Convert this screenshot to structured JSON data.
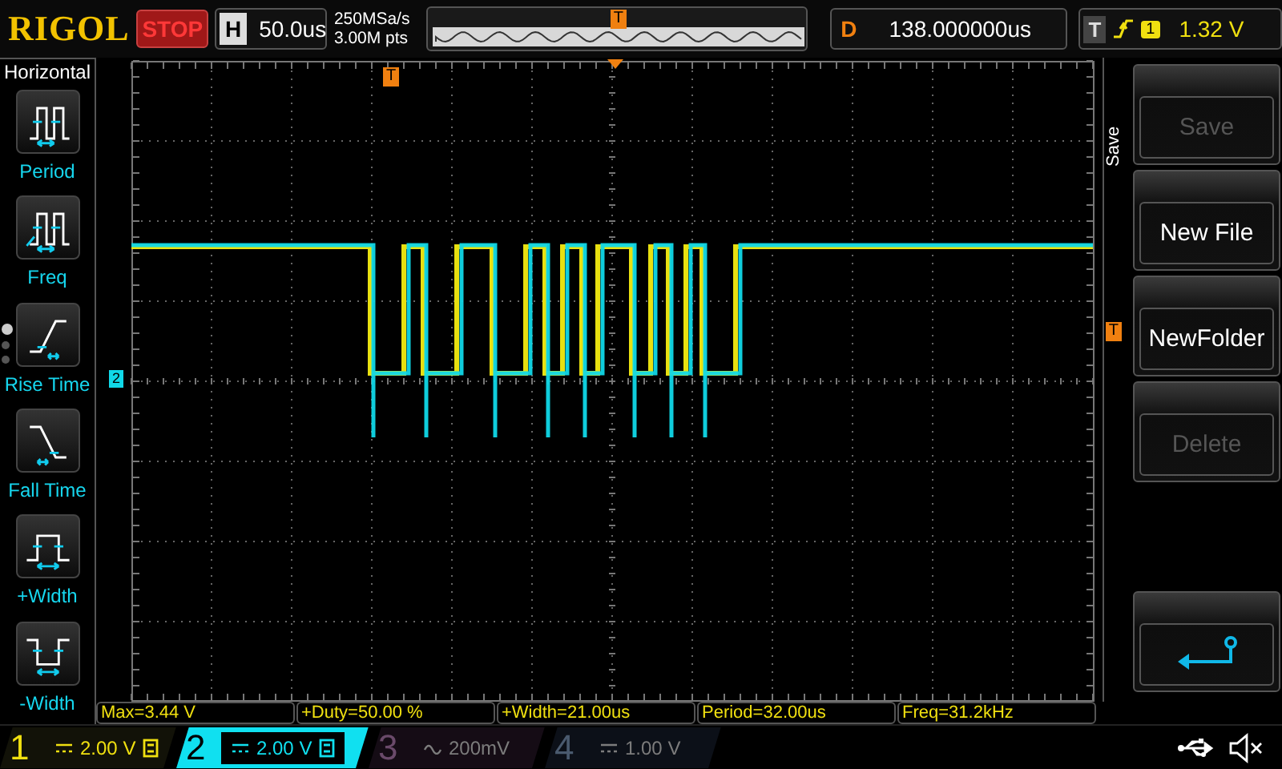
{
  "logo": "RIGOL",
  "run_state": "STOP",
  "timebase": {
    "label": "H",
    "value": "50.0us"
  },
  "sampling": {
    "rate": "250MSa/s",
    "depth": "3.00M pts"
  },
  "memory_marker": "T",
  "delay": {
    "label": "D",
    "value": "138.000000us"
  },
  "trigger": {
    "label": "T",
    "slope": {
      "kind": "rising"
    },
    "source": "1",
    "level": "1.32 V"
  },
  "scope": {
    "trigger_position_marker": "T",
    "trigger_level_marker": "T",
    "channel_marker": "2"
  },
  "left_menu": {
    "title": "Horizontal",
    "page_dots": [
      {
        "selected": true
      },
      {
        "selected": false
      },
      {
        "selected": false
      }
    ],
    "items": [
      {
        "kind": "period",
        "label": "Period"
      },
      {
        "kind": "freq",
        "label": "Freq"
      },
      {
        "kind": "rise",
        "label": "Rise Time"
      },
      {
        "kind": "fall",
        "label": "Fall Time"
      },
      {
        "kind": "pwidth",
        "label": "+Width"
      },
      {
        "kind": "nwidth",
        "label": "-Width"
      }
    ]
  },
  "right_menu": {
    "title": "Save",
    "buttons": [
      {
        "kind": "text",
        "label": "Save",
        "disabled": true
      },
      {
        "kind": "text",
        "label": "New File",
        "disabled": false
      },
      {
        "kind": "text",
        "label": "NewFolder",
        "disabled": false
      },
      {
        "kind": "text",
        "label": "Delete",
        "disabled": true
      },
      {
        "kind": "spacer"
      },
      {
        "kind": "back"
      }
    ]
  },
  "measurements": [
    "Max=3.44 V",
    "+Duty=50.00 %",
    "+Width=21.00us",
    "Period=32.00us",
    "Freq=31.2kHz"
  ],
  "channels": [
    {
      "number": "1",
      "coupling": {
        "kind": "dc"
      },
      "scale": "2.00 V",
      "bw_limit": true,
      "on": true,
      "selected": false,
      "color": "#f0e010"
    },
    {
      "number": "2",
      "coupling": {
        "kind": "dc"
      },
      "scale": "2.00 V",
      "bw_limit": true,
      "on": true,
      "selected": true,
      "color": "#10e0f0"
    },
    {
      "number": "3",
      "coupling": {
        "kind": "ac"
      },
      "scale": "200mV",
      "bw_limit": false,
      "on": false,
      "selected": false,
      "color": "#6a4a6a"
    },
    {
      "number": "4",
      "coupling": {
        "kind": "dc"
      },
      "scale": "1.00 V",
      "bw_limit": false,
      "on": false,
      "selected": false,
      "color": "#4a5a6e"
    }
  ]
}
